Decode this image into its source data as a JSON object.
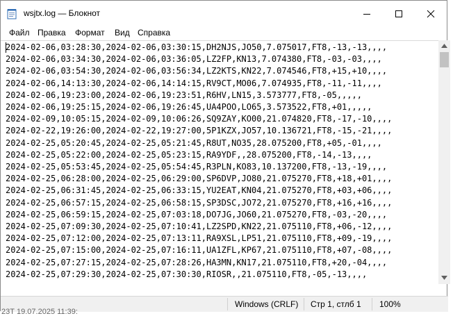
{
  "window": {
    "title": "wsjtx.log — Блокнот"
  },
  "menu": [
    "Файл",
    "Правка",
    "Формат",
    "Вид",
    "Справка"
  ],
  "lines": [
    "2024-02-06,03:28:30,2024-02-06,03:30:15,DH2NJS,JO50,7.075017,FT8,-13,-13,,,,",
    "2024-02-06,03:34:30,2024-02-06,03:36:05,LZ2FP,KN13,7.074380,FT8,-03,-03,,,,",
    "2024-02-06,03:54:30,2024-02-06,03:56:34,LZ2KTS,KN22,7.074546,FT8,+15,+10,,,,",
    "2024-02-06,14:13:30,2024-02-06,14:14:15,RV9CT,MO06,7.074935,FT8,-11,-11,,,,",
    "2024-02-06,19:23:00,2024-02-06,19:23:51,R6HV,LN15,3.573777,FT8,-05,,,,,",
    "2024-02-06,19:25:15,2024-02-06,19:26:45,UA4POO,LO65,3.573522,FT8,+01,,,,,",
    "2024-02-09,10:05:15,2024-02-09,10:06:26,SQ9ZAY,KO00,21.074820,FT8,-17,-10,,,,",
    "2024-02-22,19:26:00,2024-02-22,19:27:00,5P1KZX,JO57,10.136721,FT8,-15,-21,,,,",
    "2024-02-25,05:20:45,2024-02-25,05:21:45,R8UT,NO35,28.075200,FT8,+05,-01,,,,",
    "2024-02-25,05:22:00,2024-02-25,05:23:15,RA9YDF,,28.075200,FT8,-14,-13,,,,",
    "2024-02-25,05:53:45,2024-02-25,05:54:45,R3PLN,KO83,10.137200,FT8,-13,-19,,,,",
    "2024-02-25,06:28:00,2024-02-25,06:29:00,SP6DVP,JO80,21.075270,FT8,+18,+01,,,,",
    "2024-02-25,06:31:45,2024-02-25,06:33:15,YU2EAT,KN04,21.075270,FT8,+03,+06,,,,",
    "2024-02-25,06:57:15,2024-02-25,06:58:15,SP3DSC,JO72,21.075270,FT8,+16,+16,,,,",
    "2024-02-25,06:59:15,2024-02-25,07:03:18,DO7JG,JO60,21.075270,FT8,-03,-20,,,,",
    "2024-02-25,07:09:30,2024-02-25,07:10:41,LZ2SPD,KN22,21.075110,FT8,+06,-12,,,,",
    "2024-02-25,07:12:00,2024-02-25,07:13:11,RA9XSL,LP51,21.075110,FT8,+09,-19,,,,",
    "2024-02-25,07:15:00,2024-02-25,07:16:11,UA1ZFL,KP67,21.075110,FT8,+07,-08,,,,",
    "2024-02-25,07:27:15,2024-02-25,07:28:26,HA3MN,KN17,21.075110,FT8,+20,-04,,,,",
    "2024-02-25,07:29:30,2024-02-25,07:30:30,RIOSR,,21.075110,FT8,-05,-13,,,,"
  ],
  "status": {
    "encoding": "Windows (CRLF)",
    "position": "Стр 1, стлб 1",
    "zoom": "100%"
  },
  "below_text": "23Т 19.07.2025 11:39:"
}
